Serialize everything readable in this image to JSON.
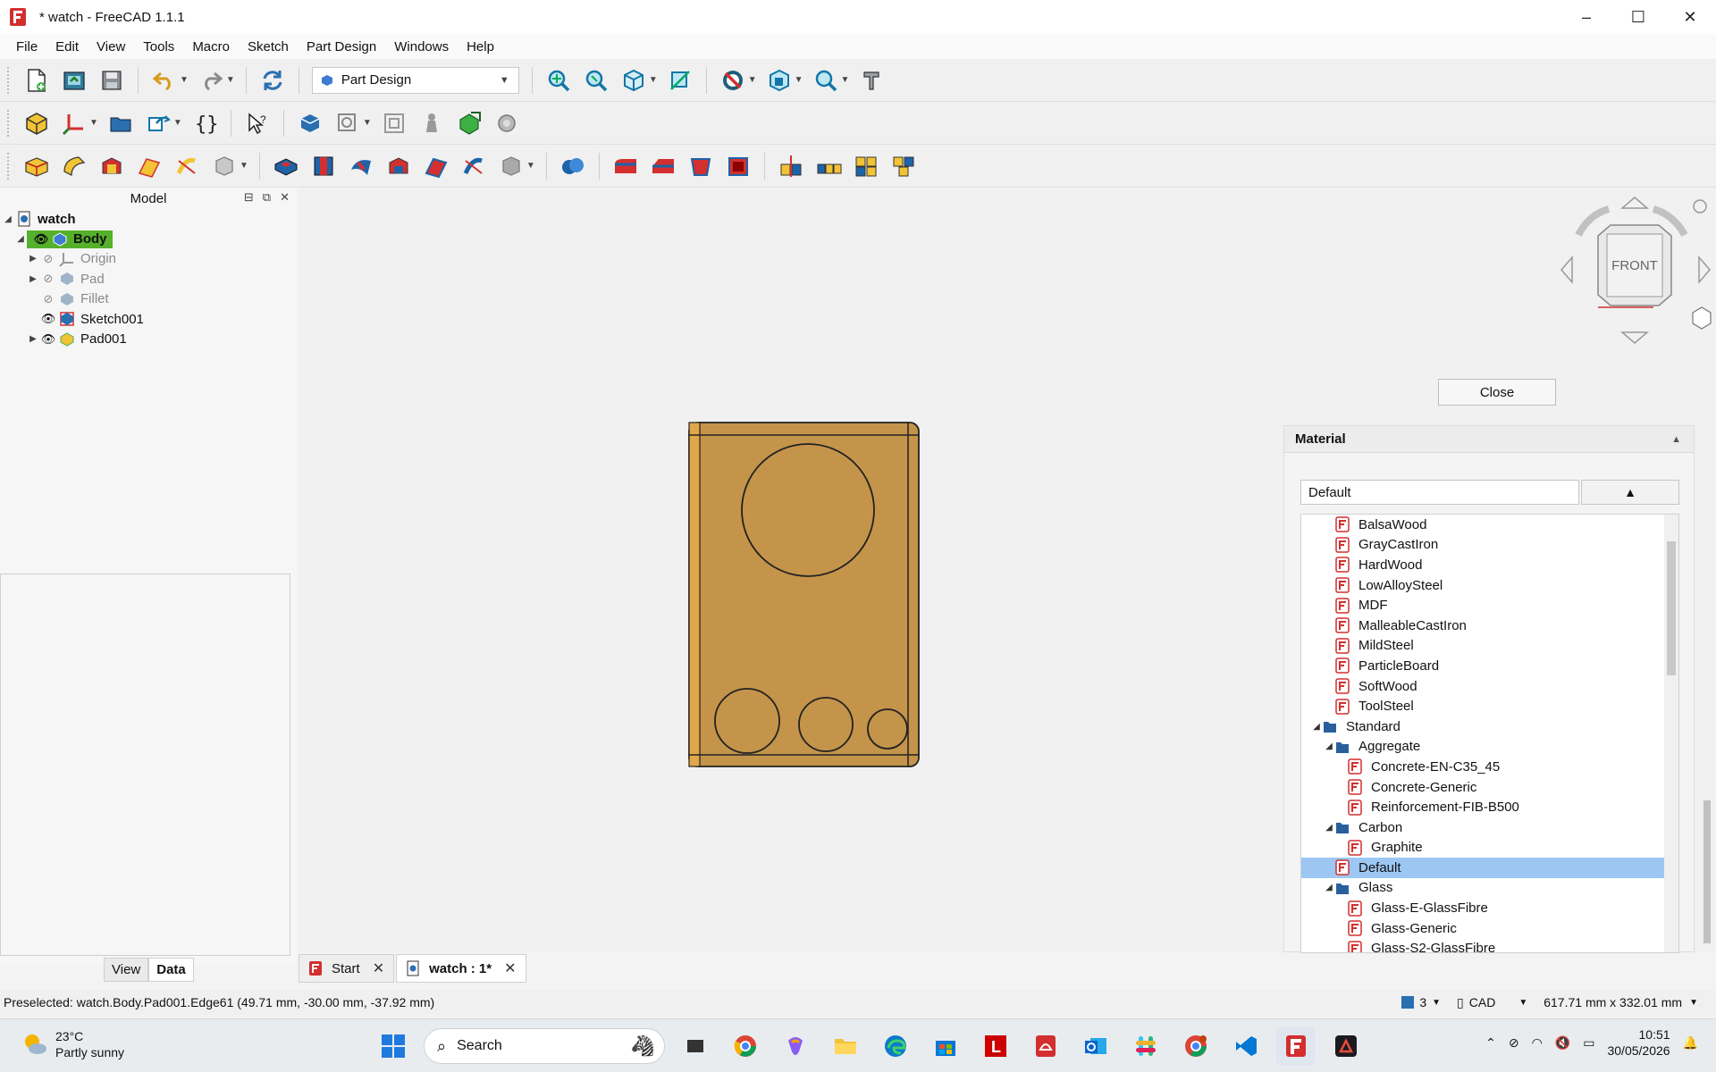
{
  "window": {
    "title": "* watch - FreeCAD 1.1.1",
    "minimize": "–",
    "maximize": "☐",
    "close": "✕"
  },
  "menu": [
    "File",
    "Edit",
    "View",
    "Tools",
    "Macro",
    "Sketch",
    "Part Design",
    "Windows",
    "Help"
  ],
  "toolbar": {
    "workbench": "Part Design"
  },
  "model_panel": {
    "title": "Model",
    "tree": {
      "root": "watch",
      "body": "Body",
      "items": [
        "Origin",
        "Pad",
        "Fillet",
        "Sketch001",
        "Pad001"
      ]
    },
    "tabs": [
      "View",
      "Data"
    ]
  },
  "task_panel": {
    "close_label": "Close",
    "material_title": "Material",
    "selected": "Default",
    "list": [
      {
        "label": "BalsaWood",
        "level": 2,
        "kind": "mat"
      },
      {
        "label": "GrayCastIron",
        "level": 2,
        "kind": "mat"
      },
      {
        "label": "HardWood",
        "level": 2,
        "kind": "mat"
      },
      {
        "label": "LowAlloySteel",
        "level": 2,
        "kind": "mat"
      },
      {
        "label": "MDF",
        "level": 2,
        "kind": "mat"
      },
      {
        "label": "MalleableCastIron",
        "level": 2,
        "kind": "mat"
      },
      {
        "label": "MildSteel",
        "level": 2,
        "kind": "mat"
      },
      {
        "label": "ParticleBoard",
        "level": 2,
        "kind": "mat"
      },
      {
        "label": "SoftWood",
        "level": 2,
        "kind": "mat"
      },
      {
        "label": "ToolSteel",
        "level": 2,
        "kind": "mat"
      },
      {
        "label": "Standard",
        "level": 1,
        "kind": "folder"
      },
      {
        "label": "Aggregate",
        "level": 2,
        "kind": "folder"
      },
      {
        "label": "Concrete-EN-C35_45",
        "level": 3,
        "kind": "mat"
      },
      {
        "label": "Concrete-Generic",
        "level": 3,
        "kind": "mat"
      },
      {
        "label": "Reinforcement-FIB-B500",
        "level": 3,
        "kind": "mat"
      },
      {
        "label": "Carbon",
        "level": 2,
        "kind": "folder"
      },
      {
        "label": "Graphite",
        "level": 3,
        "kind": "mat"
      },
      {
        "label": "Default",
        "level": 2,
        "kind": "mat",
        "selected": true
      },
      {
        "label": "Glass",
        "level": 2,
        "kind": "folder"
      },
      {
        "label": "Glass-E-GlassFibre",
        "level": 3,
        "kind": "mat"
      },
      {
        "label": "Glass-Generic",
        "level": 3,
        "kind": "mat"
      },
      {
        "label": "Glass-S2-GlassFibre",
        "level": 3,
        "kind": "mat"
      }
    ]
  },
  "navcube": {
    "face": "FRONT"
  },
  "doc_tabs": [
    {
      "label": "Start",
      "active": false
    },
    {
      "label": "watch : 1*",
      "active": true
    }
  ],
  "status": {
    "preselected": "Preselected: watch.Body.Pad001.Edge61 (49.71 mm, -30.00 mm, -37.92 mm)",
    "draw_style": "3",
    "nav_style": "CAD",
    "dimensions": "617.71 mm x 332.01 mm"
  },
  "taskbar": {
    "temp": "23°C",
    "weather": "Partly sunny",
    "search": "Search",
    "time": "10:51",
    "date": "30/05/2026"
  },
  "colors": {
    "model_fill": "#c4944a",
    "body_highlight": "#55b02a",
    "selection": "#9cc7f3"
  }
}
